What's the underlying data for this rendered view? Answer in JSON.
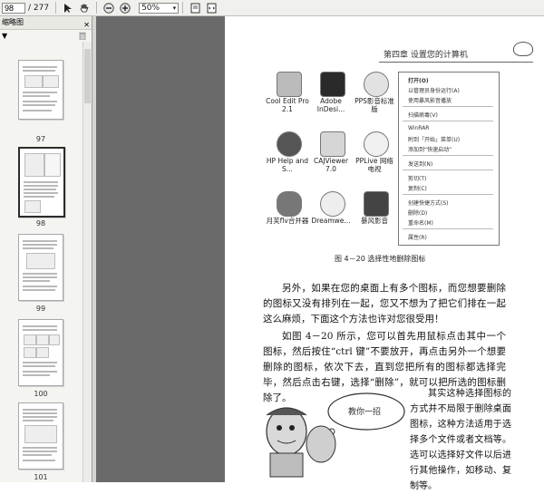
{
  "toolbar": {
    "page_value": "98",
    "page_total": "/ 277",
    "zoom": "50%"
  },
  "sidebar": {
    "title": "缩略图",
    "options": "▼",
    "thumbnails": [
      {
        "num": "97"
      },
      {
        "num": "98"
      },
      {
        "num": "99"
      },
      {
        "num": "100"
      },
      {
        "num": "101"
      }
    ]
  },
  "page": {
    "header": "第四章  设置您的计算机",
    "icons": [
      {
        "label": "Cool Edit Pro 2.1"
      },
      {
        "label": "Adobe InDesi..."
      },
      {
        "label": "PPS影音标准版"
      },
      {
        "label": "HP Help and S..."
      },
      {
        "label": "CAJViewer 7.0"
      },
      {
        "label": "PPLive 网络电视"
      },
      {
        "label": "月芙flv合并器"
      },
      {
        "label": "Dreamwe..."
      },
      {
        "label": "暴风影音"
      }
    ],
    "menu": [
      "打开(O)",
      "以管理员身份运行(A)",
      "使用暴风影音播放",
      "扫描病毒(V)",
      "WinRAR",
      "附到「开始」菜单(U)",
      "添加到“快速启动”",
      "发送到(N)",
      "剪切(T)",
      "复制(C)",
      "创建快捷方式(S)",
      "删除(D)",
      "重命名(M)",
      "属性(R)"
    ],
    "caption": "图 4－20   选择性地删除图标",
    "para1": "另外，如果在您的桌面上有多个图标，而您想要删除的图标又没有排列在一起，您又不想为了把它们排在一起这么麻烦，下面这个方法也许对您很受用！",
    "para2": "如图 4－20 所示，您可以首先用鼠标点击其中一个图标，然后按住“ctrl 键”不要放开，再点击另外一个想要删除的图标，依次下去，直到您把所有的图标都选择完毕，然后点击右键，选择“删除”，就可以把所选的图标删除了。",
    "para3": "其实这种选择图标的方式并不局限于删除桌面图标，这种方法适用于选择多个文件或者文档等。选可以选择好文件以后进行其他操作，如移动、复制等。",
    "bubble": "教你一招"
  }
}
